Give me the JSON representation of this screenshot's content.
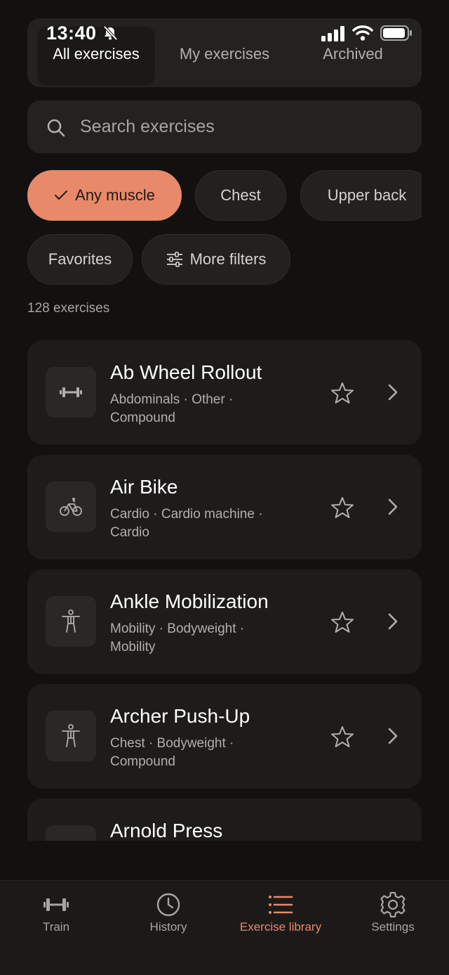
{
  "status_bar": {
    "time": "13:40"
  },
  "tabs": [
    {
      "label": "All exercises",
      "active": true
    },
    {
      "label": "My exercises",
      "active": false
    },
    {
      "label": "Archived",
      "active": false
    }
  ],
  "search": {
    "placeholder": "Search exercises"
  },
  "filters": {
    "muscle_chips": [
      {
        "label": "Any muscle",
        "active": true
      },
      {
        "label": "Chest",
        "active": false
      },
      {
        "label": "Upper back",
        "active": false
      }
    ],
    "favorites_label": "Favorites",
    "more_filters_label": "More filters"
  },
  "count_text": "128 exercises",
  "exercises": [
    {
      "name": "Ab Wheel Rollout",
      "sub1": "Abdominals · Other ·",
      "sub2": "Compound",
      "icon": "dumbbell-icon"
    },
    {
      "name": "Air Bike",
      "sub1": "Cardio · Cardio machine ·",
      "sub2": "Cardio",
      "icon": "bike-icon"
    },
    {
      "name": "Ankle Mobilization",
      "sub1": "Mobility · Bodyweight ·",
      "sub2": "Mobility",
      "icon": "person-icon"
    },
    {
      "name": "Archer Push-Up",
      "sub1": "Chest · Bodyweight ·",
      "sub2": "Compound",
      "icon": "person-icon"
    },
    {
      "name": "Arnold Press",
      "sub1": "",
      "sub2": "",
      "icon": "dumbbell-icon"
    }
  ],
  "bottom_nav": [
    {
      "label": "Train",
      "icon": "dumbbell-icon",
      "active": false
    },
    {
      "label": "History",
      "icon": "clock-icon",
      "active": false
    },
    {
      "label": "Exercise library",
      "icon": "list-icon",
      "active": true
    },
    {
      "label": "Settings",
      "icon": "gear-icon",
      "active": false
    }
  ],
  "colors": {
    "accent": "#e8896a",
    "background": "#121110",
    "card": "#1e1c1b"
  }
}
